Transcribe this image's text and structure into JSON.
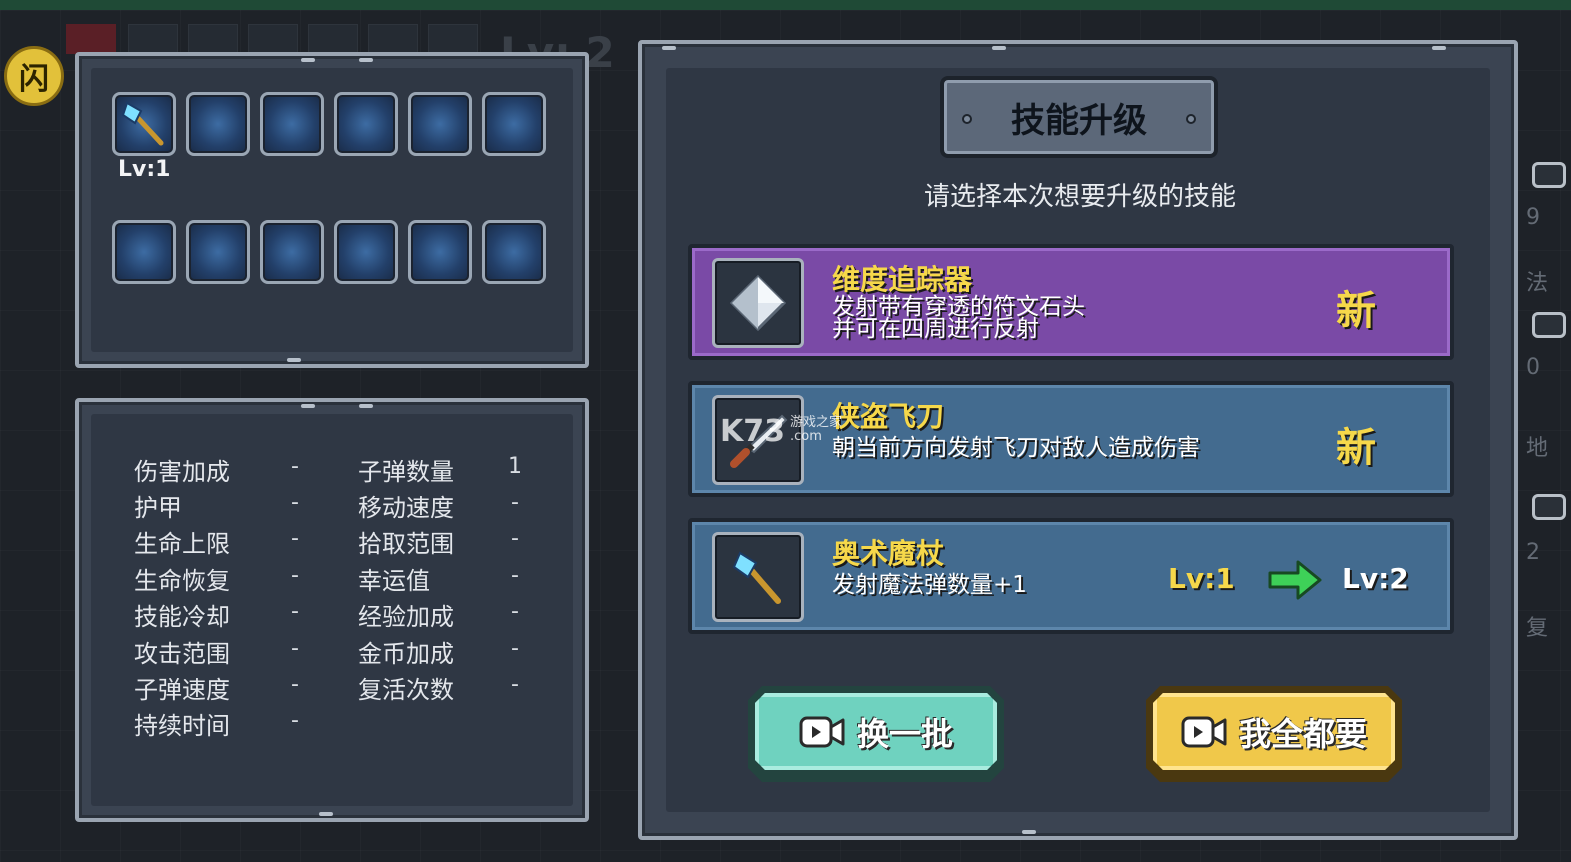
{
  "hud": {
    "pause_label": "闪",
    "level_text": "Lv: 2",
    "right_edge": [
      "9",
      "法",
      "0",
      "地",
      "2",
      "复"
    ]
  },
  "skill_slots": {
    "level_label": "Lv:1",
    "filled_slot_icon": "arcane-staff-icon"
  },
  "stats": {
    "left": [
      {
        "label": "伤害加成",
        "value": "-"
      },
      {
        "label": "护甲",
        "value": "-"
      },
      {
        "label": "生命上限",
        "value": "-"
      },
      {
        "label": "生命恢复",
        "value": "-"
      },
      {
        "label": "技能冷却",
        "value": "-"
      },
      {
        "label": "攻击范围",
        "value": "-"
      },
      {
        "label": "子弹速度",
        "value": "-"
      },
      {
        "label": "持续时间",
        "value": "-"
      }
    ],
    "right": [
      {
        "label": "子弹数量",
        "value": "1"
      },
      {
        "label": "移动速度",
        "value": "-"
      },
      {
        "label": "拾取范围",
        "value": "-"
      },
      {
        "label": "幸运值",
        "value": "-"
      },
      {
        "label": "经验加成",
        "value": "-"
      },
      {
        "label": "金币加成",
        "value": "-"
      },
      {
        "label": "复活次数",
        "value": "-"
      }
    ]
  },
  "upgrade": {
    "title": "技能升级",
    "subtitle": "请选择本次想要升级的技能",
    "options": [
      {
        "name": "维度追踪器",
        "desc_line1": "发射带有穿透的符文石头",
        "desc_line2": "并可在四周进行反射",
        "badge": "新",
        "icon": "rune-stone-icon",
        "color": "#7a4aa6"
      },
      {
        "name": "侠盗飞刀",
        "desc_line1": "朝当前方向发射飞刀对敌人造成伤害",
        "badge": "新",
        "icon": "throwing-knife-icon",
        "color": "#436b8f"
      },
      {
        "name": "奥术魔杖",
        "desc_line1": "发射魔法弹数量+1",
        "lv_from": "Lv:1",
        "lv_to": "Lv:2",
        "icon": "arcane-staff-icon",
        "color": "#436b8f"
      }
    ],
    "refresh_button": "换一批",
    "take_all_button": "我全都要"
  },
  "watermark": {
    "logo": "K73",
    "line1": "游戏之家",
    "line2": ".com"
  },
  "colors": {
    "accent_gold": "#f6d84a",
    "teal": "#6fd2bf",
    "purple": "#7a4aa6",
    "blue": "#436b8f"
  }
}
